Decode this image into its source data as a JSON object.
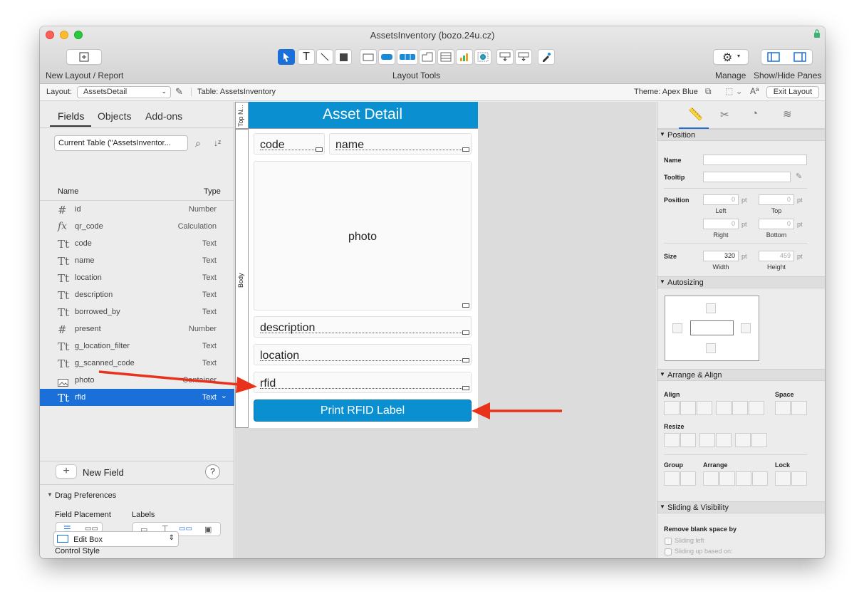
{
  "window": {
    "title": "AssetsInventory (bozo.24u.cz)"
  },
  "toolbar": {
    "new_layout_label": "New Layout / Report",
    "layout_tools_label": "Layout Tools",
    "manage_label": "Manage",
    "show_hide_label": "Show/Hide Panes"
  },
  "layoutbar": {
    "layout_label": "Layout:",
    "layout_value": "AssetsDetail",
    "table_label": "Table: AssetsInventory",
    "theme_label": "Theme: Apex Blue",
    "exit_label": "Exit Layout"
  },
  "left": {
    "tabs": [
      "Fields",
      "Objects",
      "Add-ons"
    ],
    "table_select": "Current Table (\"AssetsInventor...",
    "col_name": "Name",
    "col_type": "Type",
    "fields": [
      {
        "icon": "#",
        "name": "id",
        "type": "Number"
      },
      {
        "icon": "fx",
        "name": "qr_code",
        "type": "Calculation"
      },
      {
        "icon": "Tt",
        "name": "code",
        "type": "Text"
      },
      {
        "icon": "Tt",
        "name": "name",
        "type": "Text"
      },
      {
        "icon": "Tt",
        "name": "location",
        "type": "Text"
      },
      {
        "icon": "Tt",
        "name": "description",
        "type": "Text"
      },
      {
        "icon": "Tt",
        "name": "borrowed_by",
        "type": "Text"
      },
      {
        "icon": "#",
        "name": "present",
        "type": "Number"
      },
      {
        "icon": "Tt",
        "name": "g_location_filter",
        "type": "Text"
      },
      {
        "icon": "Tt",
        "name": "g_scanned_code",
        "type": "Text"
      },
      {
        "icon": "img",
        "name": "photo",
        "type": "Container"
      },
      {
        "icon": "Tt",
        "name": "rfid",
        "type": "Text"
      }
    ],
    "new_field_label": "New Field",
    "help_label": "?",
    "drag_prefs_label": "Drag Preferences",
    "field_placement_label": "Field Placement",
    "labels_label": "Labels",
    "control_style_label": "Control Style",
    "control_style_value": "Edit Box"
  },
  "canvas": {
    "top_part_label": "Top N...",
    "body_part_label": "Body",
    "header_title": "Asset Detail",
    "fields": {
      "code": "code",
      "name": "name",
      "photo": "photo",
      "description": "description",
      "location": "location",
      "rfid": "rfid"
    },
    "button_label": "Print RFID Label"
  },
  "inspector": {
    "position_section": "Position",
    "name_label": "Name",
    "tooltip_label": "Tooltip",
    "position_label": "Position",
    "left_val": "0",
    "top_val": "0",
    "right_val": "0",
    "bottom_val": "0",
    "pt": "pt",
    "left_label": "Left",
    "top_label": "Top",
    "right_label": "Right",
    "bottom_label": "Bottom",
    "size_label": "Size",
    "width_val": "320",
    "height_val": "459",
    "width_label": "Width",
    "height_label": "Height",
    "autosizing_section": "Autosizing",
    "arrange_section": "Arrange & Align",
    "align_label": "Align",
    "space_label": "Space",
    "resize_label": "Resize",
    "group_label": "Group",
    "arrange_label": "Arrange",
    "lock_label": "Lock",
    "sliding_section": "Sliding & Visibility",
    "remove_blank_label": "Remove blank space by",
    "sliding_left_label": "Sliding left",
    "sliding_up_label": "Sliding up based on:"
  },
  "colors": {
    "accent": "#0a8fd1",
    "selection": "#1b6fd8",
    "arrow": "#e8321b"
  }
}
